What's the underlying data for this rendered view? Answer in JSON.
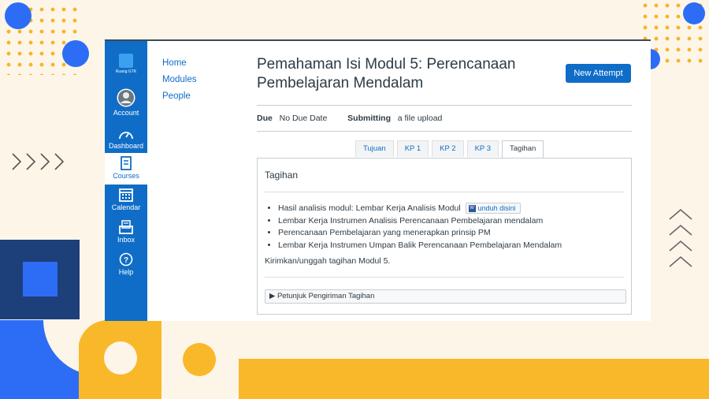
{
  "sidebar": {
    "logo_text": "Ruang GTK",
    "items": [
      {
        "label": "Account",
        "icon": "avatar-icon"
      },
      {
        "label": "Dashboard",
        "icon": "dashboard-icon"
      },
      {
        "label": "Courses",
        "icon": "book-icon"
      },
      {
        "label": "Calendar",
        "icon": "calendar-icon"
      },
      {
        "label": "Inbox",
        "icon": "inbox-icon"
      },
      {
        "label": "Help",
        "icon": "help-icon"
      }
    ]
  },
  "course_nav": [
    "Home",
    "Modules",
    "People"
  ],
  "assignment": {
    "title": "Pemahaman Isi Modul 5: Perencanaan Pembelajaran Mendalam",
    "new_attempt_label": "New Attempt",
    "due_label": "Due",
    "due_value": "No Due Date",
    "submitting_label": "Submitting",
    "submitting_value": "a file upload"
  },
  "tabs": [
    "Tujuan",
    "KP 1",
    "KP 2",
    "KP 3",
    "Tagihan"
  ],
  "active_tab": "Tagihan",
  "panel": {
    "title": "Tagihan",
    "items": [
      "Hasil analisis modul: Lembar Kerja Analisis Modul",
      "Lembar Kerja Instrumen Analisis Perencanaan Pembelajaran mendalam",
      "Perencanaan Pembelajaran yang menerapkan prinsip PM",
      "Lembar Kerja Instrumen Umpan Balik Perencanaan Pembelajaran Mendalam"
    ],
    "download_label": "unduh disini",
    "instruction": "Kirimkan/unggah tagihan Modul 5.",
    "details_label": "▶ Petunjuk Pengiriman Tagihan"
  },
  "colors": {
    "accent": "#0f6dc7",
    "decor_blue": "#2d6df6",
    "decor_yellow": "#f9b82a",
    "decor_navy": "#1d3f7a"
  }
}
